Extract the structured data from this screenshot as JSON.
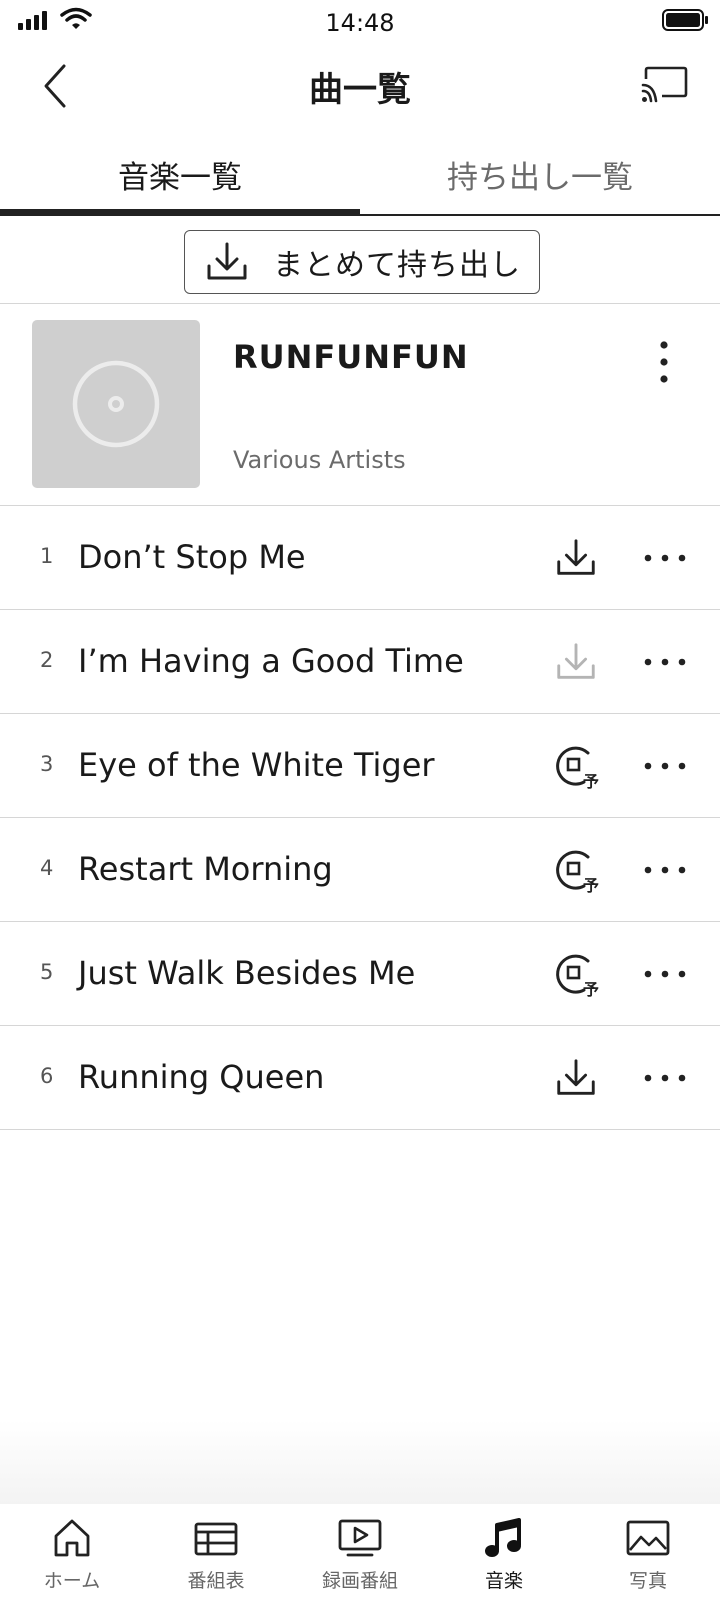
{
  "status_bar": {
    "time": "14:48"
  },
  "header": {
    "title": "曲一覧"
  },
  "tabs": [
    {
      "label": "音楽一覧",
      "active": true
    },
    {
      "label": "持ち出し一覧",
      "active": false
    }
  ],
  "bulk_button": {
    "label": "まとめて持ち出し"
  },
  "album": {
    "title": "RUNFUNFUN",
    "artist": "Various Artists"
  },
  "tracks": [
    {
      "number": "1",
      "title": "Don’t Stop Me",
      "status": "download"
    },
    {
      "number": "2",
      "title": "I’m Having a Good Time",
      "status": "download-disabled"
    },
    {
      "number": "3",
      "title": "Eye of the White Tiger",
      "status": "reserved"
    },
    {
      "number": "4",
      "title": "Restart Morning",
      "status": "reserved"
    },
    {
      "number": "5",
      "title": "Just Walk Besides Me",
      "status": "reserved"
    },
    {
      "number": "6",
      "title": "Running Queen",
      "status": "download"
    }
  ],
  "reserved_mark": "予",
  "bottom_nav": [
    {
      "label": "ホーム",
      "icon": "home-icon"
    },
    {
      "label": "番組表",
      "icon": "tv-guide-icon"
    },
    {
      "label": "録画番組",
      "icon": "recorded-icon"
    },
    {
      "label": "音楽",
      "icon": "music-icon",
      "active": true
    },
    {
      "label": "写真",
      "icon": "photo-icon"
    }
  ],
  "colors": {
    "text": "#1a1a1a",
    "muted": "#6b6b6b",
    "divider": "#d6d6d6",
    "disabled_icon": "#b4b4b4",
    "cover": "#cfcfcf"
  }
}
